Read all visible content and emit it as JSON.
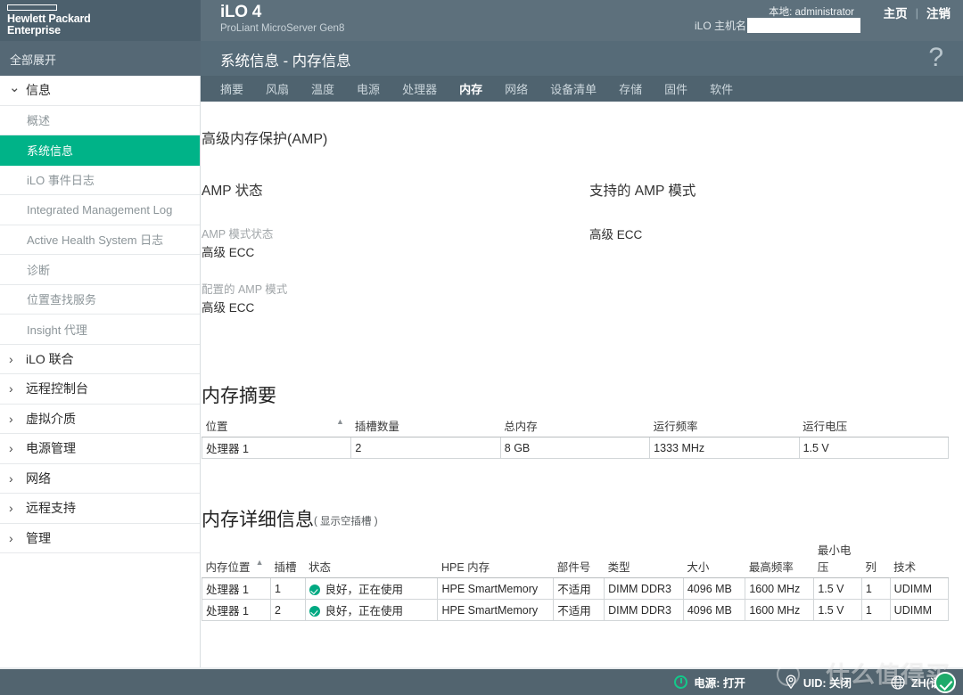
{
  "brand": {
    "company_line1": "Hewlett Packard",
    "company_line2": "Enterprise",
    "product": "iLO 4",
    "model": "ProLiant MicroServer Gen8"
  },
  "header": {
    "local_user": "本地: administrator",
    "hostname_label": "iLO 主机名",
    "hostname_value": "",
    "home_link": "主页",
    "separator": "|",
    "logout_link": "注销",
    "help_icon": "?"
  },
  "sidebar": {
    "expand_all": "全部展开",
    "items": [
      {
        "label": "信息",
        "type": "group",
        "icon": "chevron-down-icon",
        "expanded": true,
        "active": false
      },
      {
        "label": "概述",
        "type": "child",
        "active": false
      },
      {
        "label": "系统信息",
        "type": "child",
        "active": true
      },
      {
        "label": "iLO 事件日志",
        "type": "child",
        "active": false
      },
      {
        "label": "Integrated Management Log",
        "type": "child",
        "active": false
      },
      {
        "label": "Active Health System 日志",
        "type": "child",
        "active": false
      },
      {
        "label": "诊断",
        "type": "child",
        "active": false
      },
      {
        "label": "位置查找服务",
        "type": "child",
        "active": false
      },
      {
        "label": "Insight 代理",
        "type": "child",
        "active": false
      },
      {
        "label": "iLO 联合",
        "type": "group",
        "icon": "chevron-right-icon",
        "expanded": false,
        "active": false
      },
      {
        "label": "远程控制台",
        "type": "group",
        "icon": "chevron-right-icon",
        "expanded": false,
        "active": false
      },
      {
        "label": "虚拟介质",
        "type": "group",
        "icon": "chevron-right-icon",
        "expanded": false,
        "active": false
      },
      {
        "label": "电源管理",
        "type": "group",
        "icon": "chevron-right-icon",
        "expanded": false,
        "active": false
      },
      {
        "label": "网络",
        "type": "group",
        "icon": "chevron-right-icon",
        "expanded": false,
        "active": false
      },
      {
        "label": "远程支持",
        "type": "group",
        "icon": "chevron-right-icon",
        "expanded": false,
        "active": false
      },
      {
        "label": "管理",
        "type": "group",
        "icon": "chevron-right-icon",
        "expanded": false,
        "active": false
      }
    ]
  },
  "page": {
    "title": "系统信息 - 内存信息"
  },
  "tabs": [
    {
      "label": "摘要",
      "active": false
    },
    {
      "label": "风扇",
      "active": false
    },
    {
      "label": "温度",
      "active": false
    },
    {
      "label": "电源",
      "active": false
    },
    {
      "label": "处理器",
      "active": false
    },
    {
      "label": "内存",
      "active": true
    },
    {
      "label": "网络",
      "active": false
    },
    {
      "label": "设备清单",
      "active": false
    },
    {
      "label": "存储",
      "active": false
    },
    {
      "label": "固件",
      "active": false
    },
    {
      "label": "软件",
      "active": false
    }
  ],
  "amp": {
    "section_title": "高级内存保护(AMP)",
    "status_heading": "AMP 状态",
    "mode_status_label": "AMP 模式状态",
    "mode_status_value": "高级 ECC",
    "configured_mode_label": "配置的 AMP 模式",
    "configured_mode_value": "高级 ECC",
    "supported_heading": "支持的 AMP 模式",
    "supported_value": "高级 ECC"
  },
  "memory_summary": {
    "title": "内存摘要",
    "sort_column": "位置",
    "sort_direction": "asc",
    "columns": [
      "位置",
      "插槽数量",
      "总内存",
      "运行频率",
      "运行电压"
    ],
    "rows": [
      [
        "处理器 1",
        "2",
        "8 GB",
        "1333 MHz",
        "1.5 V"
      ]
    ]
  },
  "memory_detail": {
    "title": "内存详细信息",
    "subtitle": "( 显示空插槽 )",
    "sort_column": "内存位置",
    "sort_direction": "asc",
    "columns": [
      "内存位置",
      "插槽",
      "状态",
      "HPE 内存",
      "部件号",
      "类型",
      "大小",
      "最高频率",
      "最小电压",
      "列",
      "技术"
    ],
    "rows": [
      {
        "location": "处理器 1",
        "slot": "1",
        "status_icon": "status-ok-icon",
        "status": "良好，正在使用",
        "hpe_memory": "HPE SmartMemory",
        "part_number": "不适用",
        "type": "DIMM DDR3",
        "size": "4096 MB",
        "max_frequency": "1600 MHz",
        "min_voltage": "1.5 V",
        "ranks": "1",
        "technology": "UDIMM"
      },
      {
        "location": "处理器 1",
        "slot": "2",
        "status_icon": "status-ok-icon",
        "status": "良好，正在使用",
        "hpe_memory": "HPE SmartMemory",
        "part_number": "不适用",
        "type": "DIMM DDR3",
        "size": "4096 MB",
        "max_frequency": "1600 MHz",
        "min_voltage": "1.5 V",
        "ranks": "1",
        "technology": "UDIMM"
      }
    ]
  },
  "statusbar": {
    "power": "电源: 打开",
    "uid": "UID: 关闭",
    "language": "ZH(语言)"
  },
  "watermark": {
    "text": "什么值得买"
  },
  "colors": {
    "header_bg": "#4c606d",
    "brand_bg": "#5d707c",
    "tabbar_bg": "#4f636f",
    "accent_green": "#00b388",
    "status_ok": "#00a982",
    "statusbar_bg": "#52646f"
  }
}
